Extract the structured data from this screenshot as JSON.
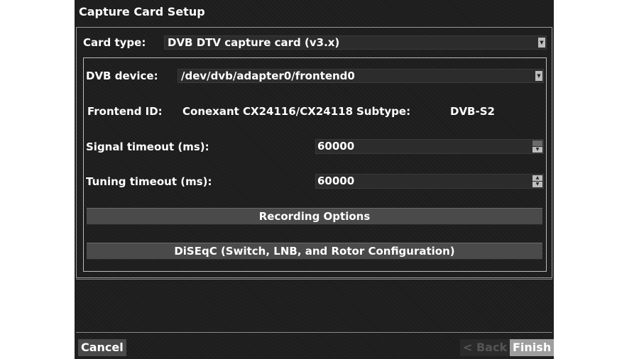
{
  "window": {
    "title": "Capture Card Setup"
  },
  "card_type": {
    "label": "Card type:",
    "value": "DVB DTV capture card (v3.x)"
  },
  "dvb_device": {
    "label": "DVB device:",
    "value": "/dev/dvb/adapter0/frontend0"
  },
  "frontend": {
    "id_label": "Frontend ID:",
    "id_value": "Conexant CX24116/CX24118",
    "subtype_label": "Subtype:",
    "subtype_value": "DVB-S2"
  },
  "signal_timeout": {
    "label": "Signal timeout (ms):",
    "value": "60000"
  },
  "tuning_timeout": {
    "label": "Tuning timeout (ms):",
    "value": "60000"
  },
  "buttons": {
    "recording_options": "Recording Options",
    "diseqc": "DiSEqC (Switch, LNB, and Rotor Configuration)",
    "cancel": "Cancel",
    "back": "< Back",
    "finish": "Finish"
  },
  "icons": {
    "dropdown": "dropdown-arrow-icon",
    "spin_up": "spin-up-icon",
    "spin_down": "spin-down-icon"
  },
  "colors": {
    "background": "#1d1d1d",
    "bar_button": "#4a4a4a",
    "finish_focus": "#9e9e9e"
  }
}
